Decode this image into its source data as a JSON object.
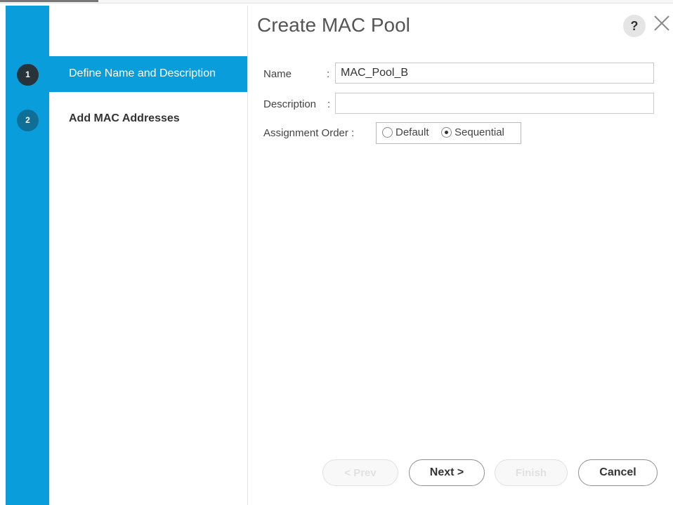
{
  "dialog": {
    "title": "Create MAC Pool"
  },
  "wizard": {
    "steps": [
      {
        "number": "1",
        "label": "Define Name and Description",
        "active": true
      },
      {
        "number": "2",
        "label": "Add MAC Addresses",
        "active": false
      }
    ]
  },
  "form": {
    "name_label": "Name",
    "name_value": "MAC_Pool_B",
    "description_label": "Description",
    "description_value": "",
    "assignment_label": "Assignment Order :",
    "assignment_options": [
      "Default",
      "Sequential"
    ],
    "assignment_selected": "Sequential"
  },
  "buttons": {
    "prev": "< Prev",
    "next": "Next >",
    "finish": "Finish",
    "cancel": "Cancel"
  },
  "colors": {
    "accent": "#0a9ddc",
    "step_active": "#27323a",
    "step_inactive": "#0f6f97"
  },
  "icons": {
    "help": "help-icon",
    "close": "close-icon"
  }
}
